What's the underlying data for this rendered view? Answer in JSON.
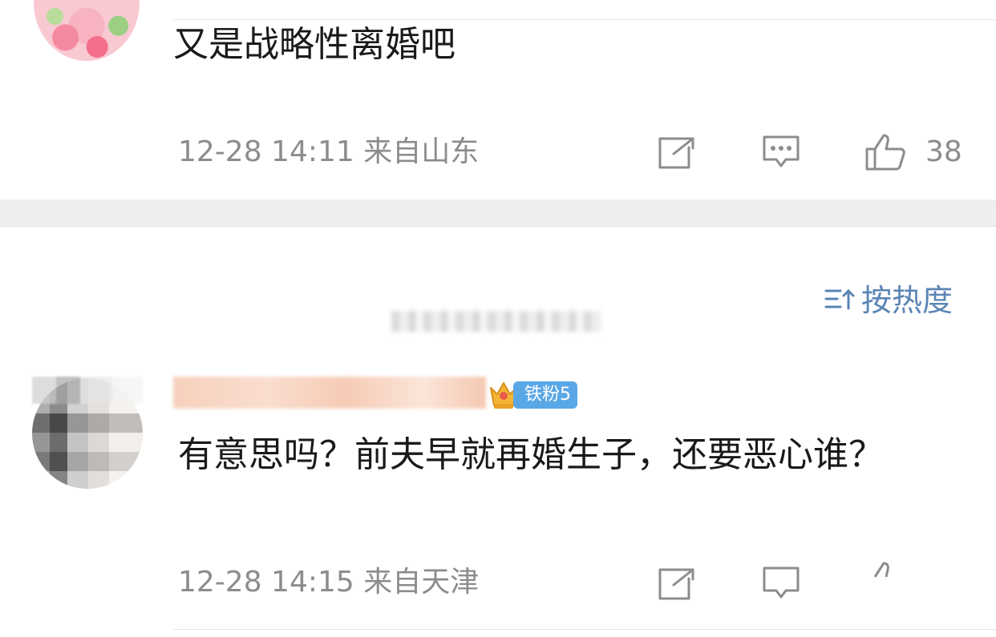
{
  "comment1": {
    "text": "又是战略性离婚吧",
    "meta": "12-28 14:11  来自山东",
    "likes": "38"
  },
  "sort": {
    "label": "按热度"
  },
  "comment2": {
    "badge": "铁粉5",
    "text": "有意思吗？前夫早就再婚生子，还要恶心谁？",
    "meta": "12-28 14:15  来自天津"
  },
  "colors": {
    "link_blue": "#5b85b5",
    "meta_gray": "#8c8c8c",
    "badge_blue": "#5aa7e6"
  },
  "icons": [
    "share-icon",
    "comment-icon",
    "like-icon",
    "sort-icon",
    "crown-icon"
  ]
}
